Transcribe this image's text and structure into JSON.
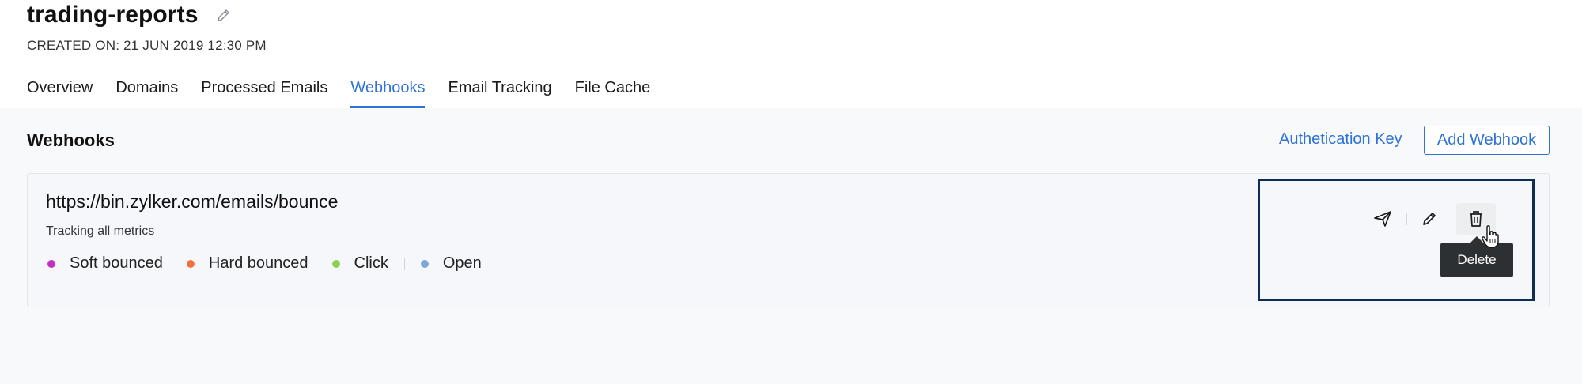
{
  "header": {
    "title": "trading-reports",
    "created_label": "CREATED ON:",
    "created_value": "21 JUN 2019 12:30 PM"
  },
  "tabs": [
    {
      "label": "Overview",
      "active": false
    },
    {
      "label": "Domains",
      "active": false
    },
    {
      "label": "Processed Emails",
      "active": false
    },
    {
      "label": "Webhooks",
      "active": true
    },
    {
      "label": "Email Tracking",
      "active": false
    },
    {
      "label": "File Cache",
      "active": false
    }
  ],
  "section": {
    "title": "Webhooks",
    "auth_key_link": "Authetication Key",
    "add_button": "Add Webhook"
  },
  "webhook": {
    "url": "https://bin.zylker.com/emails/bounce",
    "subtitle": "Tracking all metrics",
    "metrics": [
      {
        "label": "Soft bounced",
        "color": "#c42fc4"
      },
      {
        "label": "Hard bounced",
        "color": "#f0743a"
      },
      {
        "label": "Click",
        "color": "#8bd34e"
      },
      {
        "label": "Open",
        "color": "#7aa8d8"
      }
    ],
    "actions": {
      "test_icon": "send-icon",
      "edit_icon": "pencil-icon",
      "delete_icon": "trash-icon",
      "tooltip": "Delete"
    }
  },
  "colors": {
    "accent": "#2f72d8",
    "highlight_border": "#0d2d52",
    "tooltip_bg": "#2c3032"
  }
}
